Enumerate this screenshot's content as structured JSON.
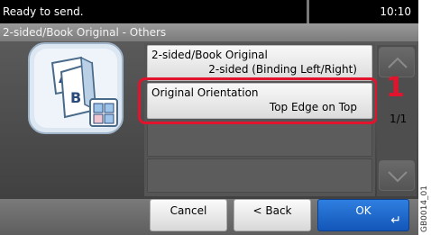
{
  "status": {
    "message": "Ready to send.",
    "time": "10:10"
  },
  "breadcrumb": "2-sided/Book Original - Others",
  "list": {
    "items": [
      {
        "line1": "2-sided/Book Original",
        "line2": "2-sided (Binding Left/Right)"
      },
      {
        "line1": "Original Orientation",
        "line2": "Top Edge on Top"
      }
    ],
    "page_indicator": "1/1"
  },
  "callout_number": "1",
  "buttons": {
    "cancel": "Cancel",
    "back": "< Back",
    "ok": "OK"
  },
  "icons": {
    "document": "2-sided-original-icon",
    "scroll_up": "chevron-up-icon",
    "scroll_down": "chevron-down-icon",
    "enter": "enter-icon"
  },
  "colors": {
    "accent": "#e2142d",
    "ok_button": "#1e6ad0"
  },
  "watermark": "GB0014_01"
}
